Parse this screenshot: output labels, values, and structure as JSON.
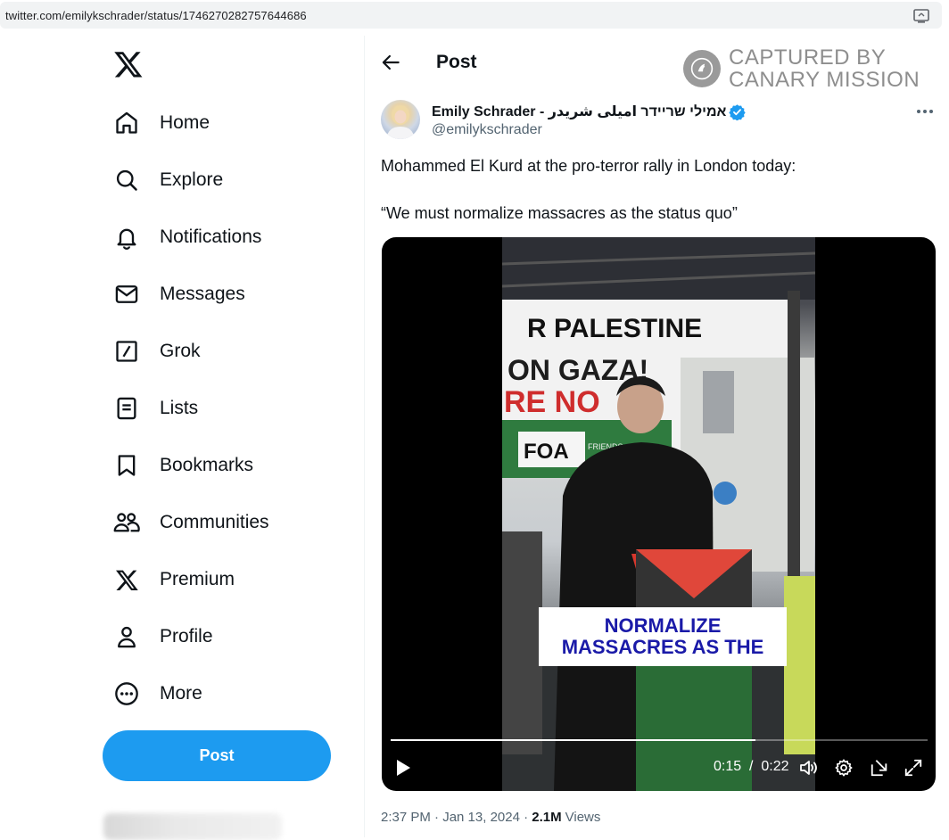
{
  "browser": {
    "url": "twitter.com/emilykschrader/status/1746270282757644686",
    "cast_icon": "cast-icon"
  },
  "nav": {
    "items": [
      {
        "label": "Home",
        "icon": "home-icon"
      },
      {
        "label": "Explore",
        "icon": "search-icon"
      },
      {
        "label": "Notifications",
        "icon": "bell-icon"
      },
      {
        "label": "Messages",
        "icon": "envelope-icon"
      },
      {
        "label": "Grok",
        "icon": "grok-icon"
      },
      {
        "label": "Lists",
        "icon": "list-icon"
      },
      {
        "label": "Bookmarks",
        "icon": "bookmark-icon"
      },
      {
        "label": "Communities",
        "icon": "people-icon"
      },
      {
        "label": "Premium",
        "icon": "x-logo-icon"
      },
      {
        "label": "Profile",
        "icon": "person-icon"
      },
      {
        "label": "More",
        "icon": "more-circle-icon"
      }
    ],
    "post_button": "Post"
  },
  "header": {
    "title": "Post"
  },
  "watermark": {
    "line1": "CAPTURED BY",
    "line2": "CANARY MISSION"
  },
  "tweet": {
    "author_name": "Emily Schrader - אמילי שריידר امیلی شریدر",
    "handle": "@emilykschrader",
    "text_line1": "Mohammed El Kurd at the pro-terror rally in London today:",
    "text_line2": "“We must normalize massacres as the status quo”",
    "video": {
      "banner_text": "R PALESTINE",
      "banner_line2": "ON GAZA!",
      "banner_line3": "RE NO",
      "sign_text": "FOA",
      "sign_small": "FRIENDS",
      "caption_line1": "NORMALIZE",
      "caption_line2": "MASSACRES AS THE",
      "time_current": "0:15",
      "time_total": "0:22",
      "progress": 0.68
    },
    "timestamp": "2:37 PM · Jan 13, 2024",
    "separator": " · ",
    "views_count": "2.1M",
    "views_label": "Views"
  },
  "colors": {
    "accent": "#1d9bf0",
    "text": "#0f1419",
    "muted": "#536471",
    "caption_text": "#1a1aa8"
  }
}
